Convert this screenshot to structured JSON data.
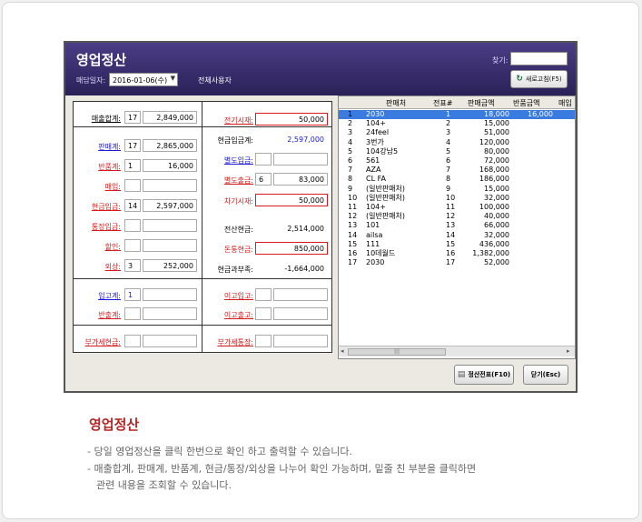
{
  "app": {
    "title": "영업정산",
    "date_label": "매담일자:",
    "date_value": "2016-01-06(수)",
    "all_users": "전체사용자",
    "search_label": "찾기:",
    "refresh_label": "새로고침(F5)"
  },
  "left": {
    "sales_total": {
      "label": "매출합계:",
      "count": "17",
      "amount": "2,849,000"
    },
    "sales_sum": {
      "label": "판매계:",
      "count": "17",
      "amount": "2,865,000"
    },
    "return_sum": {
      "label": "반품계:",
      "count": "1",
      "amount": "16,000"
    },
    "purchase": {
      "label": "매입:",
      "count": "",
      "amount": ""
    },
    "cash_deposit": {
      "label": "현금입금:",
      "count": "14",
      "amount": "2,597,000"
    },
    "bank_deposit": {
      "label": "통장입금:",
      "count": "",
      "amount": ""
    },
    "discount": {
      "label": "할인:",
      "count": "",
      "amount": ""
    },
    "credit": {
      "label": "외상:",
      "count": "3",
      "amount": "252,000"
    },
    "stock_in": {
      "label": "입고계:",
      "count": "1",
      "amount": ""
    },
    "stock_out": {
      "label": "반출계:",
      "count": "",
      "amount": ""
    },
    "vat_cash": {
      "label": "부가세현금:",
      "count": "",
      "amount": ""
    }
  },
  "mid": {
    "prev_cash": {
      "label": "전기시재:",
      "value": "50,000"
    },
    "cash_total": {
      "label": "현금입금계:",
      "value": "2,597,000"
    },
    "sep_deposit": {
      "label": "별도입금:",
      "value": ""
    },
    "sep_out": {
      "label": "별도출금:",
      "count": "6",
      "value": "83,000"
    },
    "next_cash": {
      "label": "차기시재:",
      "value": "50,000"
    },
    "settle_cash": {
      "label": "전산현금:",
      "value": "2,514,000"
    },
    "counted_cash": {
      "label": "돈통현금:",
      "value": "850,000"
    },
    "cash_diff": {
      "label": "현금과부족:",
      "value": "-1,664,000"
    },
    "transfer_in": {
      "label": "이고입고:",
      "value": ""
    },
    "transfer_out": {
      "label": "이고출고:",
      "value": ""
    },
    "vat_bank": {
      "label": "부가세통장:",
      "value": ""
    }
  },
  "grid": {
    "headers": [
      "판매처",
      "전표#",
      "판매금액",
      "반품금액",
      "매입"
    ],
    "rows": [
      {
        "no": "1",
        "seller": "2030",
        "slip": "1",
        "sale": "18,000",
        "ret": "16,000"
      },
      {
        "no": "2",
        "seller": "104+",
        "slip": "2",
        "sale": "15,000",
        "ret": ""
      },
      {
        "no": "3",
        "seller": "24feel",
        "slip": "3",
        "sale": "51,000",
        "ret": ""
      },
      {
        "no": "4",
        "seller": "3번가",
        "slip": "4",
        "sale": "120,000",
        "ret": ""
      },
      {
        "no": "5",
        "seller": "104강남5",
        "slip": "5",
        "sale": "80,000",
        "ret": ""
      },
      {
        "no": "6",
        "seller": "561",
        "slip": "6",
        "sale": "72,000",
        "ret": ""
      },
      {
        "no": "7",
        "seller": "AZA",
        "slip": "7",
        "sale": "168,000",
        "ret": ""
      },
      {
        "no": "8",
        "seller": "CL FA",
        "slip": "8",
        "sale": "186,000",
        "ret": ""
      },
      {
        "no": "9",
        "seller": "(일반판매처)",
        "slip": "9",
        "sale": "15,000",
        "ret": ""
      },
      {
        "no": "10",
        "seller": "(일반판매처)",
        "slip": "10",
        "sale": "32,000",
        "ret": ""
      },
      {
        "no": "11",
        "seller": "104+",
        "slip": "11",
        "sale": "100,000",
        "ret": ""
      },
      {
        "no": "12",
        "seller": "(일반판매처)",
        "slip": "12",
        "sale": "40,000",
        "ret": ""
      },
      {
        "no": "13",
        "seller": "101",
        "slip": "13",
        "sale": "66,000",
        "ret": ""
      },
      {
        "no": "14",
        "seller": "ailsa",
        "slip": "14",
        "sale": "32,000",
        "ret": ""
      },
      {
        "no": "15",
        "seller": "111",
        "slip": "15",
        "sale": "436,000",
        "ret": ""
      },
      {
        "no": "16",
        "seller": "10데월드",
        "slip": "16",
        "sale": "1,382,000",
        "ret": ""
      },
      {
        "no": "17",
        "seller": "2030",
        "slip": "17",
        "sale": "52,000",
        "ret": ""
      }
    ]
  },
  "buttons": {
    "settle": "정산전표(F10)",
    "close": "닫기(Esc)"
  },
  "caption": {
    "title": "영업정산",
    "line1": "- 당일 영업정산을 클릭 한번으로 확인 하고 출력할 수 있습니다.",
    "line2": "- 매출합계, 판매계, 반품계, 현금/통장/외상을 나누어 확인 가능하며, 밑줄 친 부분을 클릭하면",
    "line3": "관련 내용을 조회할 수 있습니다."
  },
  "colors": {
    "titlebar": "#2a2158",
    "label_red": "#d81a1a",
    "label_blue": "#1a1ad8",
    "selection": "#3a7be0",
    "caption_title": "#b72525"
  }
}
